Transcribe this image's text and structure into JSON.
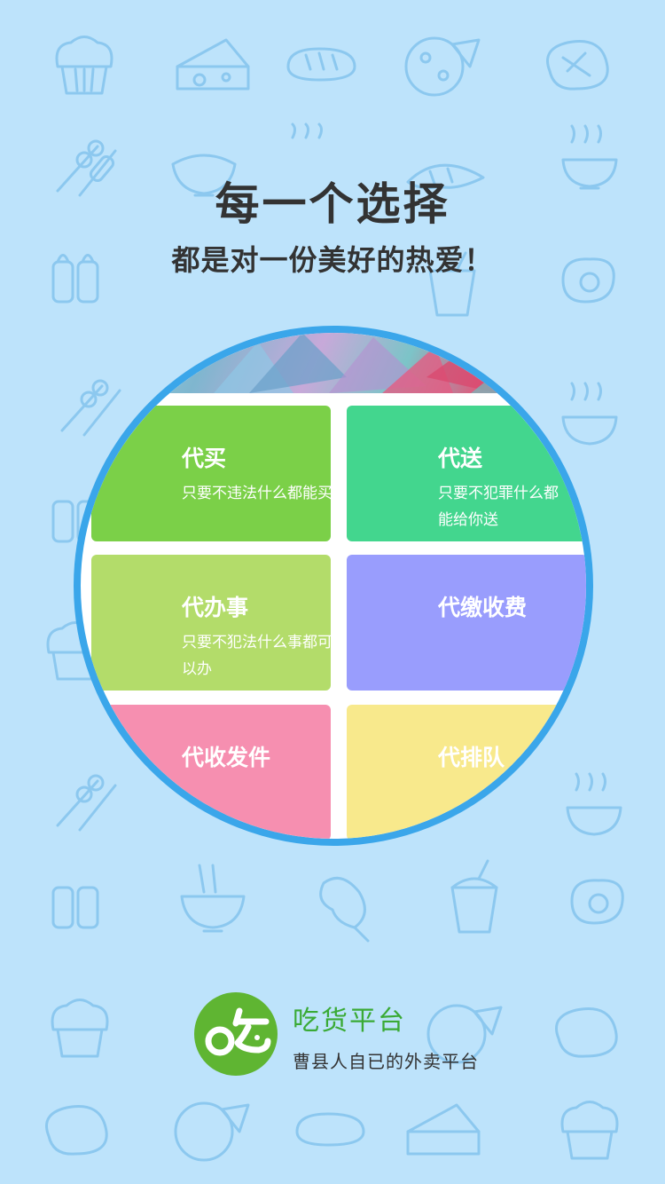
{
  "headline": "每一个选择",
  "subline": "都是对一份美好的热爱！",
  "services": [
    {
      "title": "代买",
      "desc": "只要不违法什么都能买",
      "color": "#7bd048"
    },
    {
      "title": "代送",
      "desc_line1": "只要不犯罪什么都",
      "desc_line2": "能给你送",
      "color": "#43d68e"
    },
    {
      "title": "代办事",
      "desc": "只要不犯法什么事都可以办",
      "color": "#b3dc6a"
    },
    {
      "title": "代缴收费",
      "color": "#999dfd"
    },
    {
      "title": "代收发件",
      "color": "#f68fb0"
    },
    {
      "title": "代排队",
      "color": "#f8e98c"
    }
  ],
  "brand": {
    "name": "吃货平台",
    "slogan": "曹县人自已的外卖平台",
    "logo_glyph": "吃",
    "logo_color": "#5fb532"
  },
  "background": {
    "color": "#bde3fb",
    "icon_color": "#8cc8ef",
    "icons": [
      "muffin-icon",
      "cheese-icon",
      "bread-icon",
      "pizza-icon",
      "steak-icon",
      "skewer-icon",
      "rice-bowl-icon",
      "cloche-icon",
      "croissant-icon",
      "soup-icon",
      "salt-pepper-icon",
      "egg-icon",
      "drink-icon",
      "noodle-bowl-icon",
      "chicken-leg-icon"
    ]
  }
}
